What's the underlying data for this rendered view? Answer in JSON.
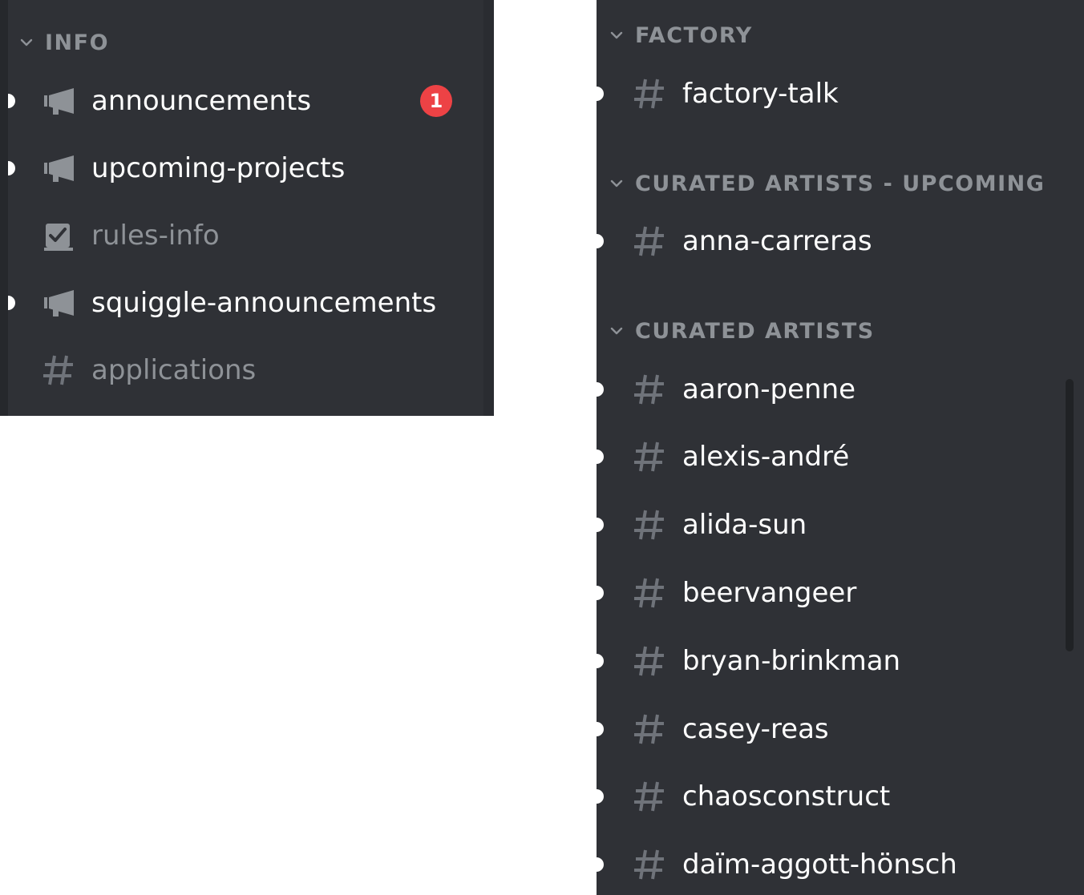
{
  "left_panel": {
    "category": {
      "label": "INFO",
      "icon": "chevron-down-icon"
    },
    "channels": [
      {
        "name": "announcements",
        "icon": "megaphone-icon",
        "unread": true,
        "badge": "1"
      },
      {
        "name": "upcoming-projects",
        "icon": "megaphone-icon",
        "unread": true
      },
      {
        "name": "rules-info",
        "icon": "rules-checkbox-icon",
        "unread": false
      },
      {
        "name": "squiggle-announcements",
        "icon": "megaphone-icon",
        "unread": true
      },
      {
        "name": "applications",
        "icon": "hashtag-icon",
        "unread": false
      }
    ]
  },
  "right_panel": {
    "categories": [
      {
        "label": "FACTORY",
        "icon": "chevron-down-icon",
        "channels": [
          "factory-talk"
        ]
      },
      {
        "label": "CURATED ARTISTS - UPCOMING",
        "icon": "chevron-down-icon",
        "channels": [
          "anna-carreras"
        ]
      },
      {
        "label": "CURATED ARTISTS",
        "icon": "chevron-down-icon",
        "channels": [
          "aaron-penne",
          "alexis-andré",
          "alida-sun",
          "beervangeer",
          "bryan-brinkman",
          "casey-reas",
          "chaosconstruct",
          "daïm-aggott-hönsch"
        ]
      }
    ]
  },
  "colors": {
    "background": "#2f3136",
    "channel_text_unread": "#ffffff",
    "channel_text_muted": "#8e9297",
    "category_text": "#8e9297",
    "badge": "#ed4245"
  }
}
